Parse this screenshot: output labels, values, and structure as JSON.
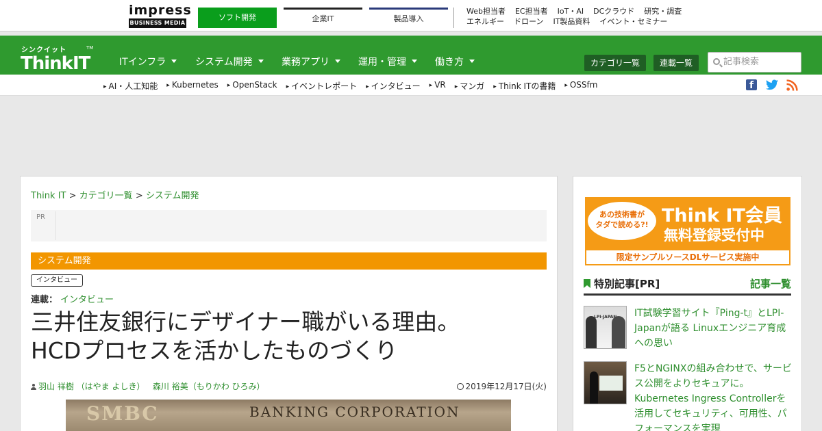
{
  "topbar": {
    "impress_word": "impress",
    "impress_sub": "BUSINESS MEDIA",
    "tabs": [
      "ソフト開発",
      "企業IT",
      "製品導入"
    ],
    "links_row1": [
      "Web担当者",
      "EC担当者",
      "IoT・AI",
      "DCクラウド",
      "研究・調査"
    ],
    "links_row2": [
      "エネルギー",
      "ドローン",
      "IT製品資料",
      "イベント・セミナー"
    ]
  },
  "logo": {
    "kana": "シンクイット",
    "main": "ThinkIT",
    "tm": "TM"
  },
  "nav": {
    "items": [
      "ITインフラ",
      "システム開発",
      "業務アプリ",
      "運用・管理",
      "働き方"
    ],
    "category_button": "カテゴリ一覧",
    "series_button": "連載一覧",
    "search_placeholder": "記事検索"
  },
  "subnav": {
    "links": [
      "AI・人工知能",
      "Kubernetes",
      "OpenStack",
      "イベントレポート",
      "インタビュー",
      "VR",
      "マンガ",
      "Think ITの書籍",
      "OSSfm"
    ],
    "social": [
      "facebook-icon",
      "twitter-icon",
      "rss-icon"
    ]
  },
  "breadcrumb": {
    "home": "Think IT",
    "sep": ">",
    "category": "カテゴリ一覧",
    "current": "システム開発"
  },
  "pr_label": "PR",
  "article": {
    "category": "システム開発",
    "tag": "インタビュー",
    "series_label": "連載：",
    "series_name": "インタビュー",
    "title_line1": "三井住友銀行にデザイナー職がいる理由。",
    "title_line2": "HCDプロセスを活かしたものづくり",
    "author1": "羽山 祥樹 （はやま よしき）",
    "author2": "森川 裕美（もりかわ ひろみ）",
    "date": "2019年12月17日(火)",
    "hero_text1": "SMBC",
    "hero_text2": "BANKING CORPORATION"
  },
  "sidebar": {
    "banner_bubble": "あの技術書が\nタダで読める?!",
    "banner_title": "Think IT会員",
    "banner_sub": "無料登録受付中",
    "banner_foot": "限定サンプルソースDLサービス実施中",
    "section_title": "特別記事[PR]",
    "section_more": "記事一覧",
    "articles": [
      {
        "text": "IT試験学習サイト『Ping-t』とLPI-Japanが語る Linuxエンジニア育成への思い",
        "thumb_label": "LPI-JAPAN"
      },
      {
        "text": "F5とNGINXの組み合わせで、サービス公開をよりセキュアに。Kubernetes Ingress Controllerを活用してセキュリティ、可用性、パフォーマンスを実現"
      }
    ]
  },
  "colors": {
    "brand_green": "#2f9a2f",
    "category_orange": "#f29600",
    "tab_active": "#0a9e1c"
  }
}
